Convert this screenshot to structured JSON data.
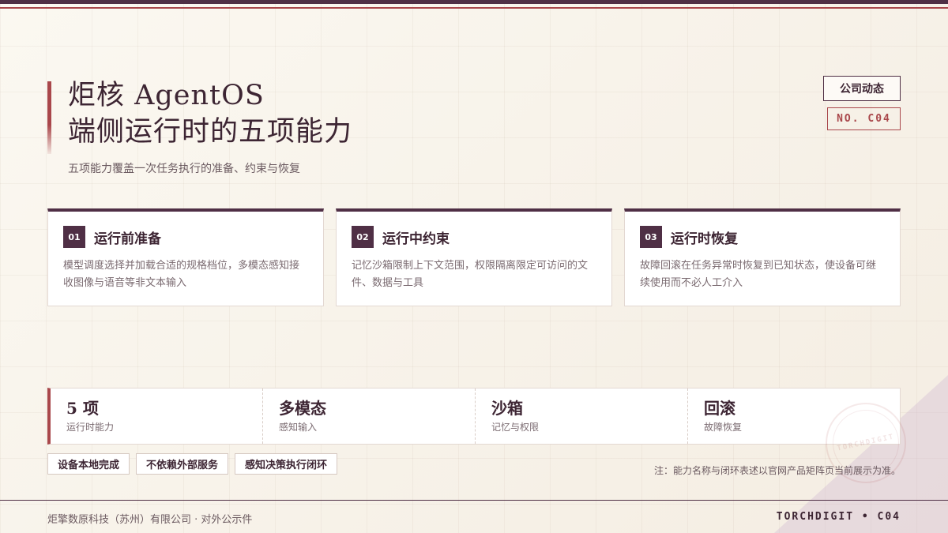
{
  "header": {
    "title_line1": "炬核 AgentOS",
    "title_line2": "端侧运行时的五项能力",
    "subtitle": "五项能力覆盖一次任务执行的准备、约束与恢复",
    "badge": "公司动态",
    "doc_no": "NO. C04"
  },
  "cards": [
    {
      "num": "01",
      "title": "运行前准备",
      "desc": "模型调度选择并加载合适的规格档位，多模态感知接收图像与语音等非文本输入"
    },
    {
      "num": "02",
      "title": "运行中约束",
      "desc": "记忆沙箱限制上下文范围，权限隔离限定可访问的文件、数据与工具"
    },
    {
      "num": "03",
      "title": "运行时恢复",
      "desc": "故障回滚在任务异常时恢复到已知状态，使设备可继续使用而不必人工介入"
    }
  ],
  "stats": [
    {
      "value": "5 项",
      "label": "运行时能力"
    },
    {
      "value": "多模态",
      "label": "感知输入"
    },
    {
      "value": "沙箱",
      "label": "记忆与权限"
    },
    {
      "value": "回滚",
      "label": "故障恢复"
    }
  ],
  "tags": [
    "设备本地完成",
    "不依赖外部服务",
    "感知决策执行闭环"
  ],
  "note": "注：能力名称与闭环表述以官网产品矩阵页当前展示为准。",
  "stamp": "TORCHDIGIT",
  "footer": {
    "left": "炬擎数原科技（苏州）有限公司 · 对外公示件",
    "right": "TORCHDIGIT • C04"
  },
  "colors": {
    "primary": "#4f2f45",
    "accent": "#a9474b",
    "background": "#f7f2ea"
  }
}
